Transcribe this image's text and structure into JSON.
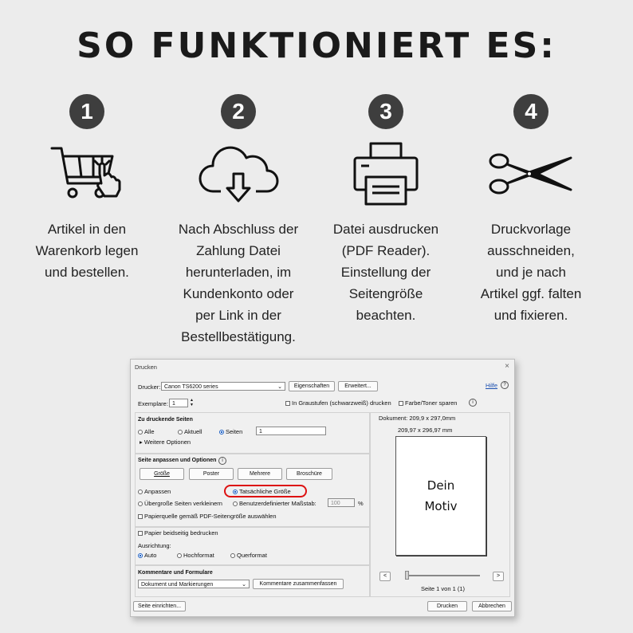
{
  "title": "SO FUNKTIONIERT ES:",
  "steps": [
    {
      "number": "1",
      "icon": "shopping-cart-icon",
      "text": "Artikel in den\nWarenkorb legen\nund bestellen."
    },
    {
      "number": "2",
      "icon": "cloud-download-icon",
      "text": "Nach Abschluss der\nZahlung Datei\nherunterladen, im\nKundenkonto oder\nper Link in der\nBestellbestätigung."
    },
    {
      "number": "3",
      "icon": "printer-icon",
      "text": "Datei ausdrucken\n(PDF Reader).\nEinstellung der\nSeitengröße\nbeachten."
    },
    {
      "number": "4",
      "icon": "scissors-icon",
      "text": "Druckvorlage\nausschneiden,\nund je nach\nArtikel ggf. falten\nund fixieren."
    }
  ],
  "dialog": {
    "title": "Drucken",
    "close": "×",
    "printer_label": "Drucker:",
    "printer_value": "Canon TS6200 series",
    "properties_button": "Eigenschaften",
    "advanced_button": "Erweitert...",
    "help_link": "Hilfe",
    "copies_label": "Exemplare:",
    "copies_value": "1",
    "grayscale_label": "In Graustufen (schwarzweiß) drucken",
    "save_ink_label": "Farbe/Toner sparen",
    "pages_header": "Zu druckende Seiten",
    "pages_all": "Alle",
    "pages_current": "Aktuell",
    "pages_pages": "Seiten",
    "pages_value": "1",
    "more_options": "Weitere Optionen",
    "fit_header": "Seite anpassen und Optionen",
    "size_button": "Größe",
    "poster_button": "Poster",
    "multiple_button": "Mehrere",
    "booklet_button": "Broschüre",
    "fit_label": "Anpassen",
    "actual_size_label": "Tatsächliche Größe",
    "shrink_label": "Übergroße Seiten verkleinern",
    "custom_scale_label": "Benutzerdefinierter Maßstab:",
    "scale_value": "100",
    "percent": "%",
    "paper_source_label": "Papierquelle gemäß PDF-Seitengröße auswählen",
    "duplex_label": "Papier beidseitig bedrucken",
    "orientation_label": "Ausrichtung:",
    "orient_auto": "Auto",
    "orient_portrait": "Hochformat",
    "orient_landscape": "Querformat",
    "comments_header": "Kommentare und Formulare",
    "comments_value": "Dokument und Markierungen",
    "summarize_button": "Kommentare zusammenfassen",
    "document_size": "Dokument: 209,9 x 297,0mm",
    "page_size": "209,97 x 296,97 mm",
    "preview_line1": "Dein",
    "preview_line2": "Motiv",
    "prev_button": "<",
    "next_button": ">",
    "page_indicator": "Seite 1 von 1 (1)",
    "page_setup_button": "Seite einrichten...",
    "print_button": "Drucken",
    "cancel_button": "Abbrechen"
  }
}
